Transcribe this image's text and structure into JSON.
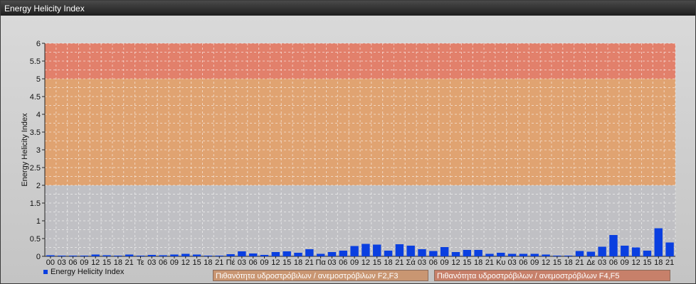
{
  "window": {
    "title": "Energy Helicity Index"
  },
  "legend": {
    "series_label": "Energy Helicity Index"
  },
  "bands": {
    "f2f3_label": "Πιθανότητα υδροστρόβιλων / ανεμοστρόβιλων F2,F3",
    "f4f5_label": "Πιθανότητα υδροστρόβιλων / ανεμοστρόβιλων F4,F5"
  },
  "colors": {
    "bar": "#0a3fe0",
    "band_low": "#c0c0c4",
    "band_mid": "#e0a371",
    "band_high": "#e2806b"
  },
  "chart_data": {
    "type": "bar",
    "ylabel": "Energy Helicity Index",
    "xlabel": "",
    "ylim": [
      0,
      6
    ],
    "yticks": [
      "0",
      "0.5",
      "1",
      "1.5",
      "2",
      "2.5",
      "3",
      "3.5",
      "4",
      "4.5",
      "5",
      "5.5",
      "6"
    ],
    "grid": true,
    "legend_position": "bottom-left",
    "bands": [
      {
        "from": 0,
        "to": 2,
        "color": "#c0c0c4"
      },
      {
        "from": 2,
        "to": 5,
        "color": "#e0a371"
      },
      {
        "from": 5,
        "to": 6,
        "color": "#e2806b"
      }
    ],
    "categories": [
      "00",
      "03",
      "06",
      "09",
      "12",
      "15",
      "18",
      "21",
      "Τε",
      "03",
      "06",
      "09",
      "12",
      "15",
      "18",
      "21",
      "Πέ",
      "03",
      "06",
      "09",
      "12",
      "15",
      "18",
      "21",
      "Πα",
      "03",
      "06",
      "09",
      "12",
      "15",
      "18",
      "21",
      "Σά",
      "03",
      "06",
      "09",
      "12",
      "15",
      "18",
      "21",
      "Κυ",
      "03",
      "06",
      "09",
      "12",
      "15",
      "18",
      "21",
      "Δε",
      "03",
      "06",
      "09",
      "12",
      "15",
      "18",
      "21"
    ],
    "series": [
      {
        "name": "Energy Helicity Index",
        "values": [
          0.03,
          0.02,
          0.02,
          0.02,
          0.05,
          0.03,
          0.02,
          0.05,
          0.02,
          0.04,
          0.03,
          0.05,
          0.07,
          0.05,
          0.02,
          0.02,
          0.06,
          0.14,
          0.08,
          0.04,
          0.12,
          0.14,
          0.1,
          0.2,
          0.07,
          0.12,
          0.16,
          0.29,
          0.35,
          0.33,
          0.16,
          0.34,
          0.3,
          0.2,
          0.15,
          0.26,
          0.12,
          0.18,
          0.18,
          0.07,
          0.1,
          0.07,
          0.07,
          0.07,
          0.05,
          0.02,
          0.02,
          0.15,
          0.13,
          0.27,
          0.6,
          0.3,
          0.25,
          0.16,
          0.79,
          0.39
        ]
      }
    ]
  }
}
